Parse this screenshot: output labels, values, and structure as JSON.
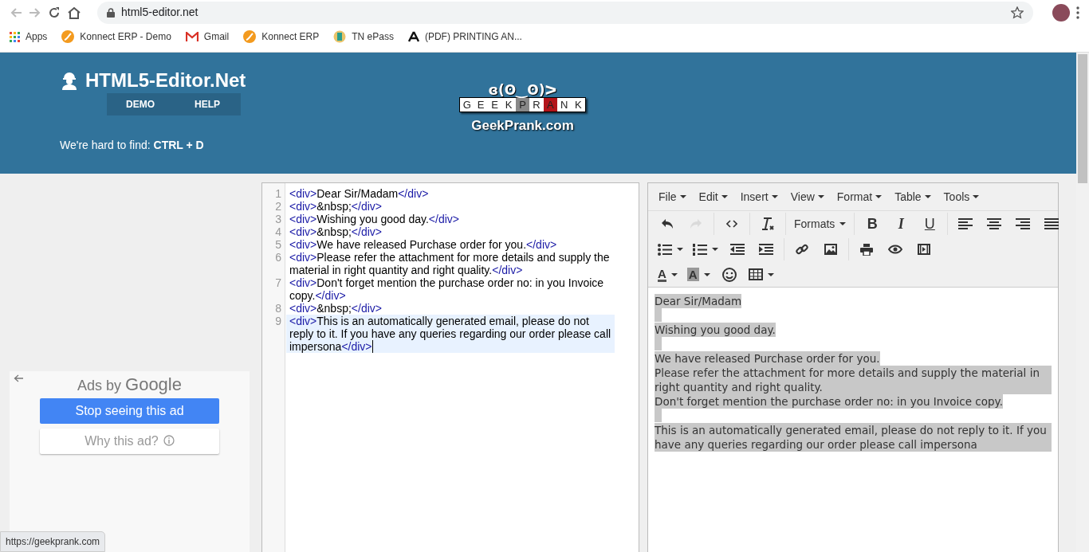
{
  "browser": {
    "url": "html5-editor.net",
    "bookmarks": [
      {
        "kind": "apps",
        "label": "Apps"
      },
      {
        "kind": "konnect",
        "label": "Konnect ERP - Demo"
      },
      {
        "kind": "gmail",
        "label": "Gmail"
      },
      {
        "kind": "konnect",
        "label": "Konnect ERP"
      },
      {
        "kind": "emblem",
        "label": "TN ePass"
      },
      {
        "kind": "serif",
        "label": "(PDF) PRINTING AN..."
      }
    ],
    "status_url": "https://geekprank.com"
  },
  "header": {
    "title": "HTML5-Editor.Net",
    "nav": [
      "DEMO",
      "HELP"
    ],
    "hint": "We're hard to find: **CTRL + D**",
    "prank_logo": {
      "face": "ɞ(ʘ‿ʘ)ᐳ",
      "letters": [
        {
          "text": "G",
          "kind": "plain"
        },
        {
          "text": "E",
          "kind": "plain"
        },
        {
          "text": "E",
          "kind": "plain"
        },
        {
          "text": "K",
          "kind": "plain"
        },
        {
          "text": "P",
          "kind": "grey"
        },
        {
          "text": "R",
          "kind": "plain"
        },
        {
          "text": "A",
          "kind": "red"
        },
        {
          "text": "N",
          "kind": "plain"
        },
        {
          "text": "K",
          "kind": "plain"
        }
      ],
      "caption": "GeekPrank.com"
    }
  },
  "ad": {
    "title": "Ads by",
    "brand": "Google",
    "buttons": [
      {
        "kind": "primary",
        "label": "Stop seeing this ad"
      },
      {
        "kind": "secondary",
        "label": "Why this ad?"
      }
    ]
  },
  "code_editor": {
    "lines": [
      {
        "number": "1",
        "active": false,
        "parts": [
          {
            "kind": "tag",
            "text": "<div>"
          },
          {
            "kind": "text",
            "text": "Dear Sir/Madam"
          },
          {
            "kind": "tag",
            "text": "</div>"
          }
        ]
      },
      {
        "number": "2",
        "active": false,
        "parts": [
          {
            "kind": "tag",
            "text": "<div>"
          },
          {
            "kind": "text",
            "text": "&nbsp;"
          },
          {
            "kind": "tag",
            "text": "</div>"
          }
        ]
      },
      {
        "number": "3",
        "active": false,
        "parts": [
          {
            "kind": "tag",
            "text": "<div>"
          },
          {
            "kind": "text",
            "text": "Wishing you good day."
          },
          {
            "kind": "tag",
            "text": "</div>"
          }
        ]
      },
      {
        "number": "4",
        "active": false,
        "parts": [
          {
            "kind": "tag",
            "text": "<div>"
          },
          {
            "kind": "text",
            "text": "&nbsp;"
          },
          {
            "kind": "tag",
            "text": "</div>"
          }
        ]
      },
      {
        "number": "5",
        "active": false,
        "parts": [
          {
            "kind": "tag",
            "text": "<div>"
          },
          {
            "kind": "text",
            "text": "We have released Purchase order for you."
          },
          {
            "kind": "tag",
            "text": "</div>"
          }
        ]
      },
      {
        "number": "6",
        "active": false,
        "parts": [
          {
            "kind": "tag",
            "text": "<div>"
          },
          {
            "kind": "text",
            "text": "Please refer the attachment for more details and supply the material in right quantity and right quality."
          },
          {
            "kind": "tag",
            "text": "</div>"
          }
        ]
      },
      {
        "number": "7",
        "active": false,
        "parts": [
          {
            "kind": "tag",
            "text": "<div>"
          },
          {
            "kind": "text",
            "text": "Don't forget mention the purchase order no: in you Invoice copy."
          },
          {
            "kind": "tag",
            "text": "</div>"
          }
        ]
      },
      {
        "number": "8",
        "active": false,
        "parts": [
          {
            "kind": "tag",
            "text": "<div>"
          },
          {
            "kind": "text",
            "text": "&nbsp;"
          },
          {
            "kind": "tag",
            "text": "</div>"
          }
        ]
      },
      {
        "number": "9",
        "active": true,
        "parts": [
          {
            "kind": "tag",
            "text": "<div>"
          },
          {
            "kind": "text",
            "text": "This is an automatically generated email, please do not reply to it. If you have any queries regarding our order please call impersona"
          },
          {
            "kind": "tag",
            "text": "</div>"
          }
        ]
      }
    ]
  },
  "rich_editor": {
    "menus": [
      "File",
      "Edit",
      "Insert",
      "View",
      "Format",
      "Table",
      "Tools"
    ],
    "toolbar": [
      [
        [
          {
            "kind": "undo",
            "disabled": false
          },
          {
            "kind": "redo",
            "disabled": true
          }
        ],
        [
          {
            "kind": "code",
            "disabled": false
          }
        ],
        [
          {
            "kind": "clearformat",
            "disabled": false
          }
        ],
        [
          {
            "kind": "dropdown",
            "text": "Formats",
            "disabled": false
          }
        ],
        [
          {
            "kind": "bold",
            "text": "B",
            "disabled": false
          },
          {
            "kind": "italic",
            "text": "I",
            "disabled": false
          },
          {
            "kind": "underline",
            "text": "U",
            "disabled": false
          }
        ],
        [
          {
            "kind": "alignleft",
            "disabled": false
          },
          {
            "kind": "aligncenter",
            "disabled": false
          },
          {
            "kind": "alignright",
            "disabled": false
          },
          {
            "kind": "justify",
            "disabled": false
          }
        ]
      ],
      [
        [
          {
            "kind": "bullets",
            "disabled": false
          },
          {
            "kind": "numbers",
            "disabled": false
          },
          {
            "kind": "outdent",
            "disabled": false
          },
          {
            "kind": "indent",
            "disabled": false
          }
        ],
        [
          {
            "kind": "link",
            "disabled": false
          },
          {
            "kind": "image",
            "disabled": false
          }
        ],
        [
          {
            "kind": "print",
            "disabled": false
          },
          {
            "kind": "preview",
            "disabled": false
          },
          {
            "kind": "media",
            "disabled": false
          }
        ]
      ],
      [
        [
          {
            "kind": "forecolor",
            "text": "A",
            "disabled": false
          },
          {
            "kind": "backcolor",
            "text": "A",
            "disabled": false
          },
          {
            "kind": "emoji",
            "disabled": false
          },
          {
            "kind": "table",
            "disabled": false
          }
        ]
      ]
    ],
    "selected": true,
    "paragraphs": [
      {
        "kind": "text",
        "text": "Dear Sir/Madam"
      },
      {
        "kind": "blank"
      },
      {
        "kind": "text",
        "text": "Wishing you good day."
      },
      {
        "kind": "blank"
      },
      {
        "kind": "text",
        "text": "We have released Purchase order for you."
      },
      {
        "kind": "text",
        "text": "Please refer the attachment for more details and supply the material in right quantity and right quality."
      },
      {
        "kind": "text",
        "text": "Don't forget mention the purchase order no: in you Invoice copy."
      },
      {
        "kind": "blank"
      },
      {
        "kind": "text",
        "text": "This is an automatically generated email, please do not reply to it. If you have any queries regarding our order please call impersona"
      }
    ]
  }
}
